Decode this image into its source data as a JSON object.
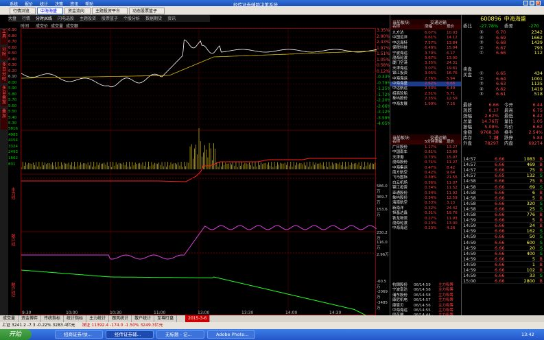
{
  "window": {
    "title": "经传证券辅助决策系统",
    "menu": [
      "系统",
      "报价",
      "统计",
      "决策",
      "资讯",
      "帮助"
    ]
  },
  "tabs": [
    "行情浏览",
    "中海海盛",
    "资金流向",
    "主题投资平台",
    "动态股票篮子"
  ],
  "subtabs": [
    "大盘",
    "行情",
    "分时/K线",
    "闪电选股",
    "主题投资",
    "股票篮子",
    "个股分析",
    "数据期货",
    "资讯"
  ],
  "toolrow": [
    "时间",
    "成交价",
    "成交量",
    "成交额"
  ],
  "sidebar": [
    "工具",
    "分时",
    "多日分时",
    "多日叠加",
    "叠加"
  ],
  "left_axis": [
    "6.90",
    "6.80",
    "6.70",
    "6.60",
    "6.50",
    "6.40",
    "6.30",
    "6.20",
    "6.10",
    "6.00",
    "5.90",
    "5.80",
    "5.70",
    "5.60",
    "5.50",
    "5.40",
    "5.30",
    "5816",
    "4985",
    "4154",
    "3324",
    "2493",
    "1662",
    "831"
  ],
  "right_axis": [
    "3.35%",
    "2.90%",
    "2.43%",
    "1.97%",
    "1.51%",
    "1.05%",
    "0.58%",
    "0.12%",
    "-0.33%",
    "-0.79%",
    "-1.25%",
    "-1.72%",
    "-2.20%",
    "-2.66%",
    "-3.12%",
    "-3.59%",
    "-4.05%"
  ],
  "indicator_labels": [
    {
      "name": "主力线",
      "values": [
        "586.0万",
        "369.7万",
        "153.6万"
      ]
    },
    {
      "name": "散户线",
      "values": [
        "230.2万",
        "116.0万",
        "2.96万"
      ]
    },
    {
      "name": "散户线2",
      "values": [
        "-60.5万",
        "-2069万",
        "-3485万"
      ]
    }
  ],
  "time_axis": [
    "9:30",
    "10:00",
    "10:30",
    "11:00",
    "13:00",
    "13:30",
    "14:00",
    "14:30"
  ],
  "panel1": {
    "title": "当前板块:",
    "sub": "交通运输",
    "cols": [
      "名称",
      "涨幅",
      "现价"
    ],
    "rows": [
      [
        "九方达",
        "6.07%",
        "10.03"
      ],
      [
        "中国远洋",
        "6.61%",
        "14.12"
      ],
      [
        "中远海特",
        "7.57%",
        "13.84"
      ],
      [
        "保税科技",
        "6.49%",
        "15.94"
      ],
      [
        "宁波海运",
        "3.70%",
        "6.17"
      ],
      [
        "渤海轮渡",
        "3.67%",
        "13.00"
      ],
      [
        "厦门空港",
        "3.35%",
        "24.31"
      ],
      [
        "天津海运",
        "3.07%",
        "19.81"
      ],
      [
        "锦江投资",
        "3.05%",
        "16.76"
      ],
      [
        "中海海运",
        "2.76%",
        "5.94"
      ],
      [
        "中海海盛",
        "2.62%",
        "6.66"
      ],
      [
        "中远航运",
        "2.53%",
        "6.49"
      ],
      [
        "招商轮船",
        "2.51%",
        "5.71"
      ],
      [
        "象屿股份",
        "2.35%",
        "12.59"
      ],
      [
        "中海发展",
        "1.99%",
        "7.16"
      ]
    ],
    "selected": 10
  },
  "panel2": {
    "title": "当前板块:",
    "sub": "交通运输",
    "cols": [
      "名称",
      "5分钟涨幅",
      "现价"
    ],
    "rows": [
      [
        "广日股份",
        "1.17%",
        "13.27"
      ],
      [
        "中国南车",
        "0.81%",
        "13.89"
      ],
      [
        "天津港",
        "0.73%",
        "15.97"
      ],
      [
        "渤海股份",
        "0.71%",
        "11.27"
      ],
      [
        "中海集运",
        "0.47%",
        "8.42"
      ],
      [
        "南方航空",
        "0.42%",
        "9.64"
      ],
      [
        "飞马国际",
        "0.39%",
        "21.55"
      ],
      [
        "白云机场",
        "0.36%",
        "11.07"
      ],
      [
        "锦江投资",
        "0.34%",
        "11.52"
      ],
      [
        "亚通股份",
        "0.34%",
        "11.92"
      ],
      [
        "象屿股份",
        "0.34%",
        "12.59"
      ],
      [
        "海南航空",
        "0.33%",
        "3.13"
      ],
      [
        "新南洋",
        "0.32%",
        "24.42"
      ],
      [
        "恒基达鑫",
        "0.31%",
        "19.76"
      ],
      [
        "铁龙物流",
        "0.27%",
        "11.93"
      ],
      [
        "渤海轮渡",
        "0.23%",
        "13.00"
      ],
      [
        "中海海运",
        "0.23%",
        "4.28"
      ]
    ]
  },
  "panel3": {
    "rows": [
      [
        "杭钢股份",
        "06/14:59",
        "主力吸筹"
      ],
      [
        "宁波富达",
        "06/14:58",
        "主力吸筹"
      ],
      [
        "浦东股份",
        "06/14:58",
        "主力吸筹"
      ],
      [
        "康尼机电",
        "06/14:57",
        "主力吸筹"
      ],
      [
        "康恩贝",
        "06/14:56",
        "主力吸筹"
      ],
      [
        "中海海运",
        "06/14:55",
        "主力吸筹"
      ],
      [
        "同花顺",
        "06/14:44",
        "主力吸筹"
      ]
    ]
  },
  "quote": {
    "code": "600896",
    "name": "中海海盛",
    "ratio_label": "委比",
    "ratio": "-27.78%",
    "diff_label": "委差",
    "diff": "-270",
    "sells": [
      [
        "⑤",
        "6.70",
        "2342"
      ],
      [
        "④",
        "6.69",
        "1662"
      ],
      [
        "③",
        "6.68",
        "1439"
      ],
      [
        "②",
        "6.67",
        "793"
      ],
      [
        "①",
        "6.66",
        "112"
      ]
    ],
    "buys": [
      [
        "①",
        "6.65",
        "434"
      ],
      [
        "②",
        "6.64",
        "1001"
      ],
      [
        "③",
        "6.63",
        "1135"
      ],
      [
        "④",
        "6.62",
        "1419"
      ],
      [
        "⑤",
        "6.61",
        "518"
      ]
    ],
    "sell_label": "卖盘",
    "buy_label": "买盘",
    "stats": [
      [
        "最新",
        "6.66",
        "今开",
        "6.44"
      ],
      [
        "涨跌",
        "0.17",
        "最高",
        "6.75"
      ],
      [
        "涨幅",
        "2.62%",
        "最低",
        "6.42"
      ],
      [
        "总量",
        "14.76万",
        "量比",
        "1.05"
      ],
      [
        "振幅",
        "5.08%",
        "均价",
        "6.62"
      ],
      [
        "金额",
        "9768.38万",
        "换手",
        "2.54%"
      ],
      [
        "库存",
        "7.14",
        "跌停",
        "5.84"
      ],
      [
        "外盘",
        "78297",
        "内盘",
        "69274"
      ]
    ]
  },
  "trades": [
    [
      "14:57",
      "6.66",
      "1083",
      "B"
    ],
    [
      "14:57",
      "6.66",
      "469",
      "B"
    ],
    [
      "14:57",
      "6.66",
      "75",
      "B"
    ],
    [
      "14:57",
      "6.65",
      "132",
      "S"
    ],
    [
      "14:58",
      "6.66",
      "75",
      "B"
    ],
    [
      "14:58",
      "6.66",
      "69",
      "S"
    ],
    [
      "14:58",
      "6.66",
      "6",
      "B"
    ],
    [
      "14:58",
      "6.66",
      "5",
      "B"
    ],
    [
      "14:58",
      "6.66",
      "320",
      "S"
    ],
    [
      "14:58",
      "6.66",
      "25",
      "S"
    ],
    [
      "14:58",
      "6.66",
      "776",
      "B"
    ],
    [
      "14:59",
      "6.66",
      "5",
      "B"
    ],
    [
      "14:59",
      "6.66",
      "24",
      "B"
    ],
    [
      "14:59",
      "6.66",
      "162",
      "S"
    ],
    [
      "14:59",
      "6.66",
      "50",
      "S"
    ],
    [
      "14:59",
      "6.66",
      "600",
      "S"
    ],
    [
      "14:59",
      "6.66",
      "20",
      "S"
    ],
    [
      "14:59",
      "6.66",
      "400",
      "S"
    ],
    [
      "14:59",
      "6.66",
      "5",
      "B"
    ],
    [
      "14:59",
      "6.66",
      "1",
      "B"
    ],
    [
      "14:59",
      "6.66",
      "102",
      "B"
    ],
    [
      "14:59",
      "6.66",
      "33",
      "S"
    ],
    [
      "15:00",
      "6.66",
      "2800",
      "B"
    ]
  ],
  "bottom_tabs": [
    "成交量",
    "资金博弈",
    "传统指标",
    "统计指标",
    "主力统计",
    "跟风统计",
    "散户统计",
    "至尊盯盘"
  ],
  "bottom_date": "2015-3-6",
  "status": {
    "sh": "上证 3241.2 -7.3 -0.22% 3283.4亿元",
    "sz": "深证 11392.4 -174.0 -1.50% 3249.3亿元"
  },
  "taskbar": {
    "start": "开始",
    "tasks": [
      "招商证券/扶...",
      "经传证券辅...",
      "无标题 - 记...",
      "Adobe Photo..."
    ],
    "clock": "13:42"
  },
  "colors": {
    "up": "#ff3030",
    "down": "#00e000",
    "price_line": "#ffffff",
    "avg_line": "#d8c000",
    "main_force": "#ff2020",
    "retail": "#e040e0",
    "third": "#20ff20"
  }
}
